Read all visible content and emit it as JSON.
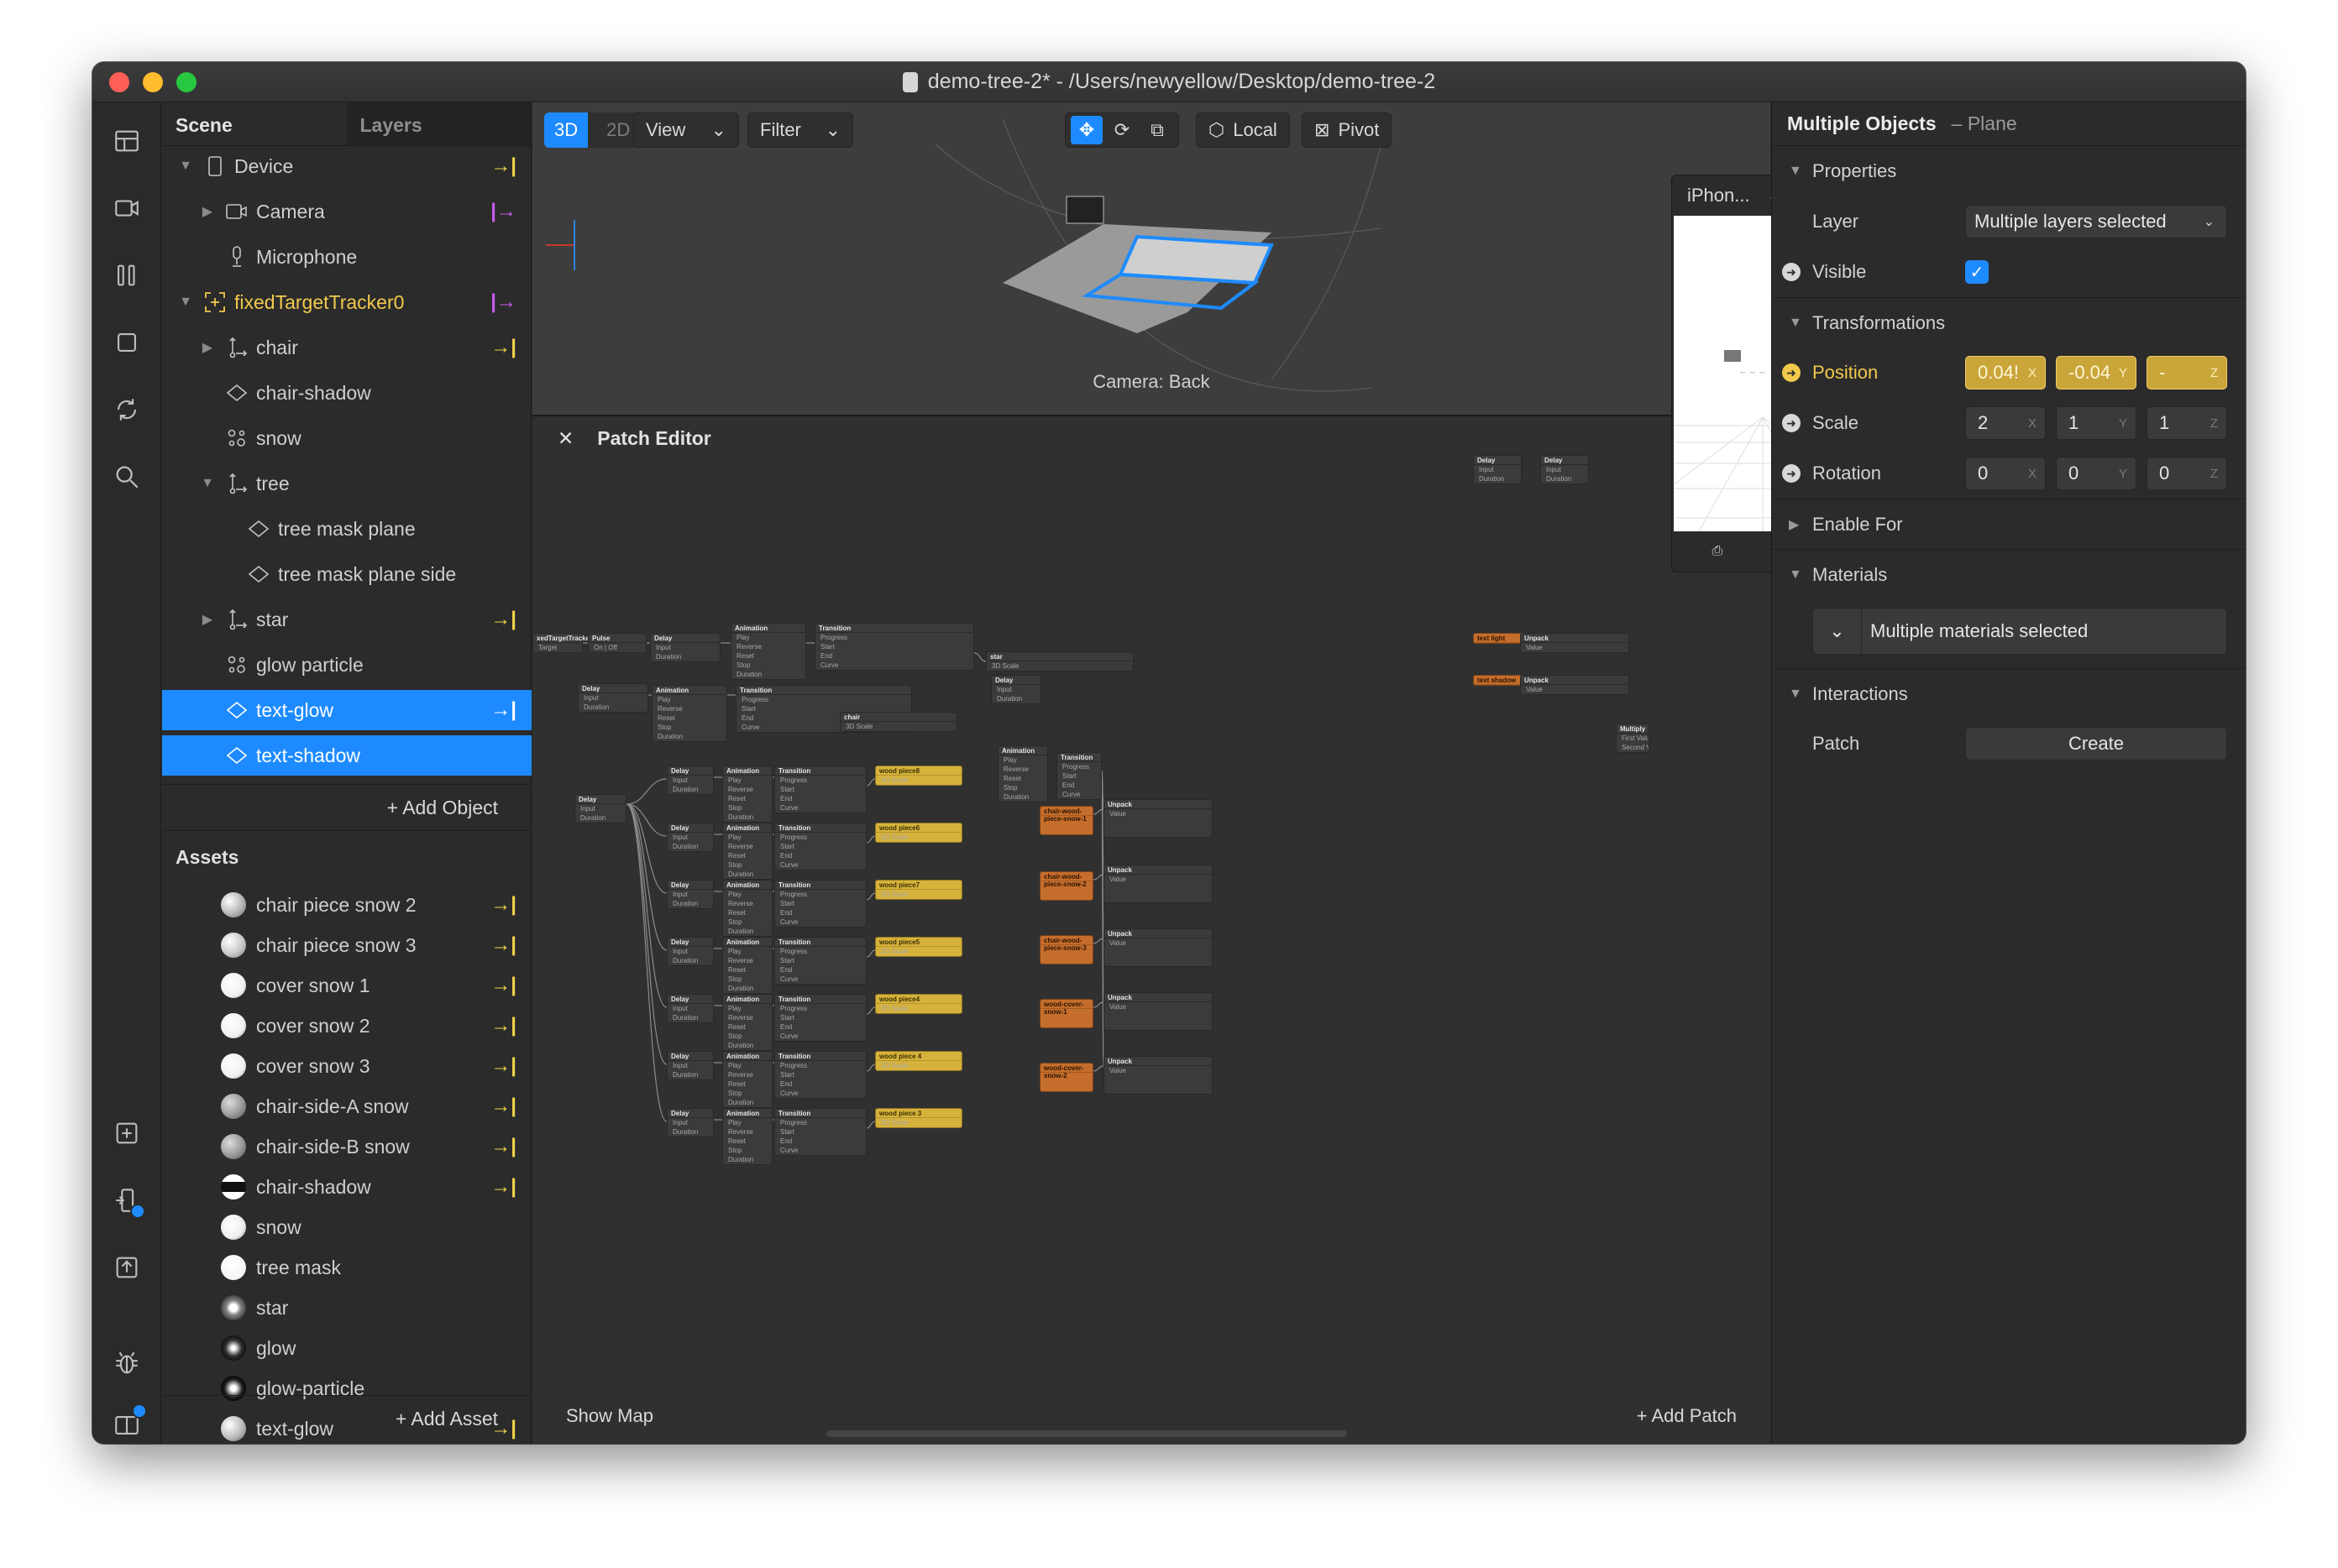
{
  "window": {
    "title": "demo-tree-2* - /Users/newyellow/Desktop/demo-tree-2"
  },
  "rail": {
    "icons": [
      "layout-icon",
      "video-icon",
      "columns-icon",
      "square-icon",
      "refresh-icon",
      "search-icon",
      "add-folder-icon",
      "device-icon",
      "export-icon",
      "bug-icon",
      "book-icon"
    ]
  },
  "scene": {
    "tabs": [
      "Scene",
      "Layers"
    ],
    "items": [
      {
        "label": "Device",
        "depth": 0,
        "caret": "open",
        "icon": "phone-icon",
        "action": "→|"
      },
      {
        "label": "Camera",
        "depth": 1,
        "caret": "closed",
        "icon": "camera-icon",
        "action": "|→"
      },
      {
        "label": "Microphone",
        "depth": 1,
        "caret": "none",
        "icon": "microphone-icon",
        "action": ""
      },
      {
        "label": "fixedTargetTracker0",
        "depth": 0,
        "caret": "open",
        "icon": "tracker-icon",
        "action": "|→"
      },
      {
        "label": "chair",
        "depth": 1,
        "caret": "closed",
        "icon": "null-object-icon",
        "action": "→|"
      },
      {
        "label": "chair-shadow",
        "depth": 1,
        "caret": "none",
        "icon": "plane-icon",
        "action": ""
      },
      {
        "label": "snow",
        "depth": 1,
        "caret": "none",
        "icon": "particle-icon",
        "action": ""
      },
      {
        "label": "tree",
        "depth": 1,
        "caret": "open",
        "icon": "null-object-icon",
        "action": ""
      },
      {
        "label": "tree mask plane",
        "depth": 2,
        "caret": "none",
        "icon": "plane-icon",
        "action": ""
      },
      {
        "label": "tree mask plane side",
        "depth": 2,
        "caret": "none",
        "icon": "plane-icon",
        "action": ""
      },
      {
        "label": "star",
        "depth": 1,
        "caret": "closed",
        "icon": "null-object-icon",
        "action": "→|"
      },
      {
        "label": "glow particle",
        "depth": 1,
        "caret": "none",
        "icon": "particle-icon",
        "action": ""
      },
      {
        "label": "text-glow",
        "depth": 1,
        "caret": "none",
        "icon": "plane-icon",
        "action": "→|",
        "selected": true
      },
      {
        "label": "text-shadow",
        "depth": 1,
        "caret": "none",
        "icon": "plane-icon",
        "action": "",
        "selected": true
      }
    ],
    "add_object": "+  Add Object"
  },
  "assets": {
    "title": "Assets",
    "items": [
      {
        "label": "chair piece snow 2",
        "action": "→|"
      },
      {
        "label": "chair piece snow 3",
        "action": "→|"
      },
      {
        "label": "cover snow 1",
        "action": "→|"
      },
      {
        "label": "cover snow 2",
        "action": "→|"
      },
      {
        "label": "cover snow 3",
        "action": "→|"
      },
      {
        "label": "chair-side-A snow",
        "action": "→|"
      },
      {
        "label": "chair-side-B snow",
        "action": "→|"
      },
      {
        "label": "chair-shadow",
        "action": "→|"
      },
      {
        "label": "snow",
        "action": ""
      },
      {
        "label": "tree mask",
        "action": ""
      },
      {
        "label": "star",
        "action": ""
      },
      {
        "label": "glow",
        "action": ""
      },
      {
        "label": "glow-particle",
        "action": ""
      },
      {
        "label": "text-glow",
        "action": "→|"
      }
    ],
    "add_asset": "+  Add Asset"
  },
  "viewport": {
    "mode_3d": "3D",
    "mode_2d": "2D",
    "view": "View",
    "filter": "Filter",
    "local": "Local",
    "pivot": "Pivot",
    "camera_label": "Camera: Back"
  },
  "preview": {
    "device": "iPhon..."
  },
  "patch_editor": {
    "title": "Patch Editor",
    "show_map": "Show Map",
    "add_patch": "+  Add Patch",
    "node_labels": {
      "tracker": "xedTargetTracker0",
      "pulse": "Pulse",
      "delay": "Delay",
      "animation": "Animation",
      "transition": "Transition",
      "unpack": "Unpack",
      "multiply": "Multiply",
      "star": "star",
      "chair": "chair",
      "text_light": "text light",
      "text_shadow": "text shadow",
      "wood_pieces": [
        "wood piece8",
        "wood piece6",
        "wood piece7",
        "wood piece5",
        "wood piece4",
        "wood piece 4",
        "wood piece 3"
      ],
      "orange_nodes": [
        "chair-wood-piece-snow-1",
        "chair-wood-piece-snow-2",
        "chair-wood-piece-snow-3",
        "wood-cover-snow-1",
        "wood-cover-snow-2"
      ]
    }
  },
  "inspector": {
    "title": "Multiple Objects",
    "subtitle": "– Plane",
    "properties": "Properties",
    "layer_label": "Layer",
    "layer_value": "Multiple layers selected",
    "visible_label": "Visible",
    "transformations": "Transformations",
    "position_label": "Position",
    "position": [
      "0.04!",
      "-0.04",
      "-"
    ],
    "scale_label": "Scale",
    "scale": [
      "2",
      "1",
      "1"
    ],
    "rotation_label": "Rotation",
    "rotation": [
      "0",
      "0",
      "0"
    ],
    "axes": [
      "X",
      "Y",
      "Z"
    ],
    "enable_for": "Enable For",
    "materials": "Materials",
    "materials_value": "Multiple materials selected",
    "interactions": "Interactions",
    "patch_label": "Patch",
    "create": "Create"
  },
  "colors": {
    "accent": "#1d8bff",
    "yellow": "#f2c94c",
    "purple": "#c85cf0",
    "node_yellow": "#d6b23c",
    "node_orange": "#c56d2c"
  }
}
